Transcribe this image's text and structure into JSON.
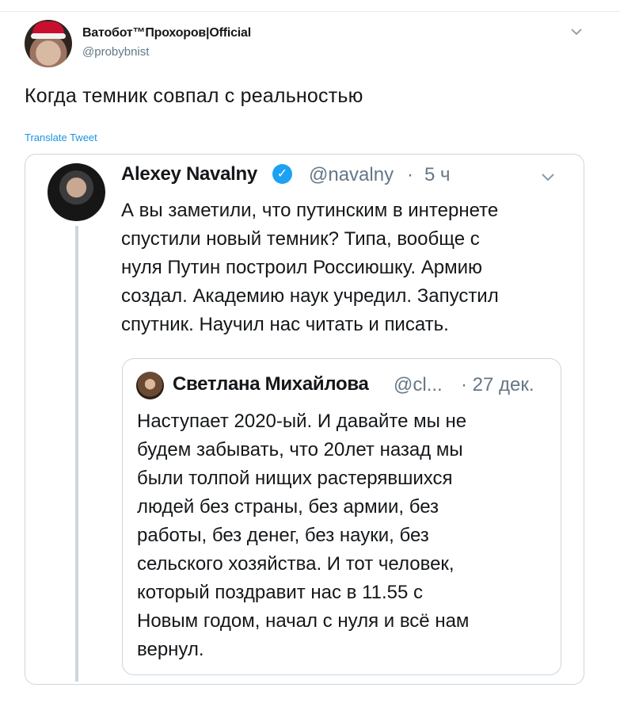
{
  "tweet": {
    "author_name": "Ватобот™Прохоров|Official",
    "author_handle": "@probybnist",
    "text": "Когда темник совпал с реальностью",
    "translate_label": "Translate Tweet"
  },
  "quoted": {
    "author_name": "Alexey Navalny",
    "verified_mark": "✓",
    "handle": "@navalny",
    "separator": "·",
    "time": "5 ч",
    "lines": [
      "А вы заметили, что путинским в интернете",
      "спустили новый темник? Типа, вообще с",
      "нуля Путин построил Россиюшку. Армию",
      "создал. Академию наук учредил. Запустил",
      "спутник. Научил нас читать и писать."
    ]
  },
  "nested": {
    "author_name": "Светлана Михайлова",
    "handle": "@cl...",
    "date": "· 27 дек.",
    "lines": [
      "Наступает 2020-ый. И давайте мы не",
      "будем забывать, что 20лет назад мы",
      "были толпой нищих растерявшихся",
      "людей без страны, без армии, без",
      "работы, без денег, без науки, без",
      "сельского хозяйства. И тот человек,",
      "который поздравит нас в 11.55 с",
      "Новым годом, начал с нуля и всё нам",
      "вернул."
    ]
  },
  "colors": {
    "link": "#1b95e0",
    "verified": "#1da1f2",
    "muted": "#657786",
    "border": "#ccd6dd"
  }
}
